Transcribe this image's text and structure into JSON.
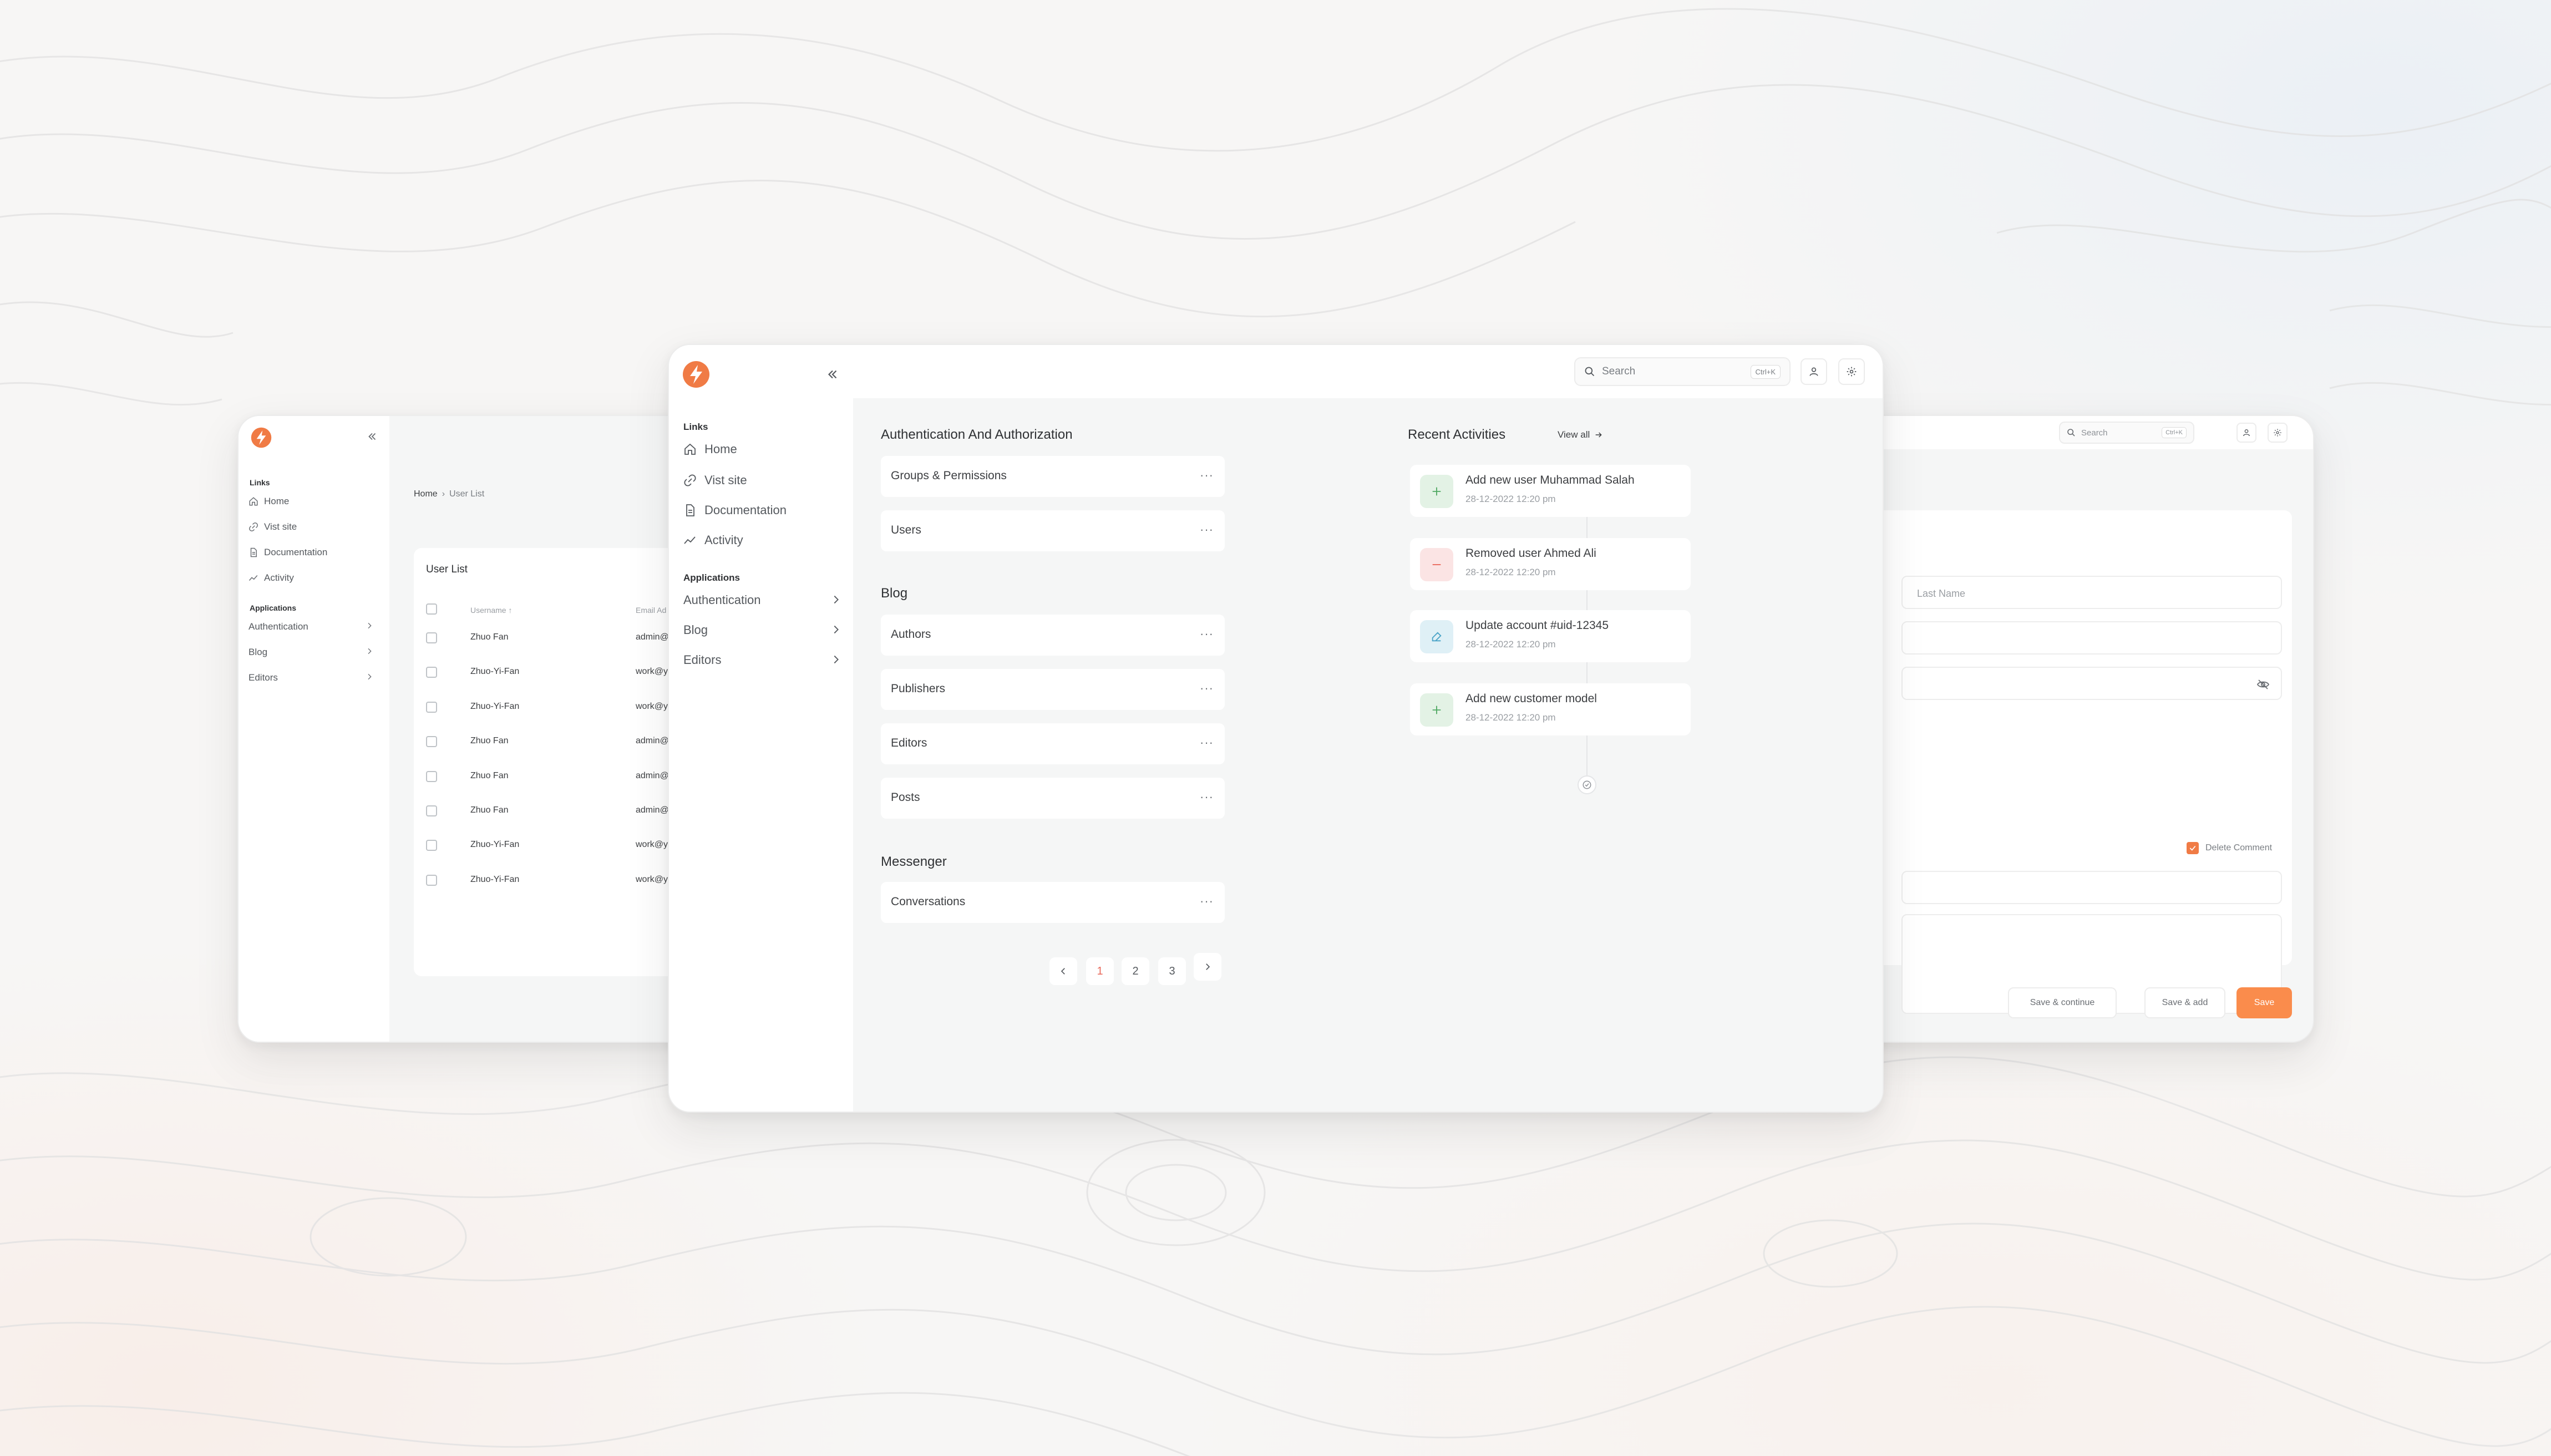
{
  "brand": {
    "accent": "#f07b45",
    "accent_light": "#fa8c4c",
    "green": "#6cc07a",
    "red": "#e9685a",
    "blue": "#4aa4c8"
  },
  "left_window": {
    "sidebar": {
      "links_title": "Links",
      "links": [
        {
          "label": "Home",
          "icon": "home-icon"
        },
        {
          "label": "Vist site",
          "icon": "link-icon"
        },
        {
          "label": "Documentation",
          "icon": "document-icon"
        },
        {
          "label": "Activity",
          "icon": "activity-icon"
        }
      ],
      "apps_title": "Applications",
      "apps": [
        {
          "label": "Authentication",
          "icon": "chevron-right-icon"
        },
        {
          "label": "Blog",
          "icon": "chevron-right-icon"
        },
        {
          "label": "Editors",
          "icon": "chevron-right-icon"
        }
      ]
    },
    "breadcrumb": {
      "home": "Home",
      "sep": "›",
      "current": "User List"
    },
    "table": {
      "title": "User List",
      "col_username": "Username",
      "col_email": "Email Ad",
      "rows": [
        {
          "username": "Zhuo Fan",
          "email": "admin@"
        },
        {
          "username": "Zhuo-Yi-Fan",
          "email": "work@y"
        },
        {
          "username": "Zhuo-Yi-Fan",
          "email": "work@y"
        },
        {
          "username": "Zhuo Fan",
          "email": "admin@"
        },
        {
          "username": "Zhuo Fan",
          "email": "admin@"
        },
        {
          "username": "Zhuo Fan",
          "email": "admin@"
        },
        {
          "username": "Zhuo-Yi-Fan",
          "email": "work@y"
        },
        {
          "username": "Zhuo-Yi-Fan",
          "email": "work@y"
        }
      ]
    }
  },
  "right_window": {
    "search": {
      "placeholder": "Search",
      "shortcut": "Ctrl+K"
    },
    "fields": {
      "last_name_placeholder": "Last Name"
    },
    "checkbox_label": "Delete Comment",
    "actions": {
      "save_continue": "Save & continue",
      "save_add": "Save & add",
      "save": "Save"
    }
  },
  "main_window": {
    "sidebar": {
      "links_title": "Links",
      "links": [
        {
          "label": "Home",
          "icon": "home-icon"
        },
        {
          "label": "Vist site",
          "icon": "link-icon"
        },
        {
          "label": "Documentation",
          "icon": "document-icon"
        },
        {
          "label": "Activity",
          "icon": "activity-icon"
        }
      ],
      "apps_title": "Applications",
      "apps": [
        {
          "label": "Authentication",
          "icon": "chevron-right-icon"
        },
        {
          "label": "Blog",
          "icon": "chevron-right-icon"
        },
        {
          "label": "Editors",
          "icon": "chevron-right-icon"
        }
      ]
    },
    "search": {
      "placeholder": "Search",
      "shortcut": "Ctrl+K"
    },
    "groups": [
      {
        "title": "Authentication And Authorization",
        "items": [
          "Groups & Permissions",
          "Users"
        ]
      },
      {
        "title": "Blog",
        "items": [
          "Authors",
          "Publishers",
          "Editors",
          "Posts"
        ]
      },
      {
        "title": "Messenger",
        "items": [
          "Conversations"
        ]
      }
    ],
    "more_label": "···",
    "pagination": {
      "pages": [
        "1",
        "2",
        "3"
      ],
      "current": "1"
    },
    "recent": {
      "title": "Recent Activities",
      "view_all": "View all",
      "items": [
        {
          "text": "Add new user Muhammad Salah",
          "date": "28-12-2022 12:20 pm",
          "kind": "add"
        },
        {
          "text": "Removed user Ahmed Ali",
          "date": "28-12-2022 12:20 pm",
          "kind": "remove"
        },
        {
          "text": "Update account #uid-12345",
          "date": "28-12-2022 12:20 pm",
          "kind": "edit"
        },
        {
          "text": "Add new customer model",
          "date": "28-12-2022 12:20 pm",
          "kind": "add"
        }
      ]
    }
  }
}
